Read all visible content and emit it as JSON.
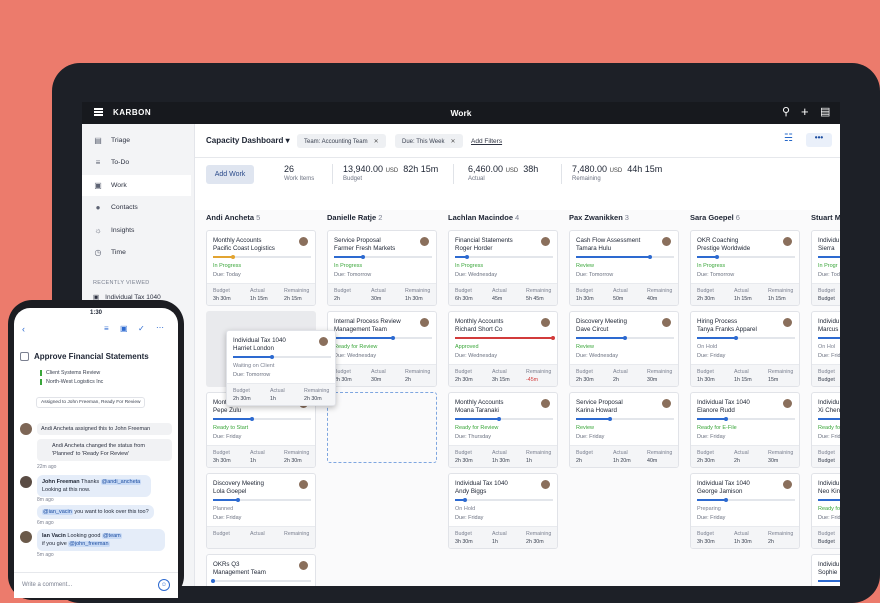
{
  "app": {
    "brand": "KARBON",
    "title": "Work"
  },
  "sidebar": {
    "items": [
      {
        "icon": "triage-icon",
        "label": "Triage"
      },
      {
        "icon": "todo-icon",
        "label": "To-Do"
      },
      {
        "icon": "briefcase-icon",
        "label": "Work"
      },
      {
        "icon": "contacts-icon",
        "label": "Contacts"
      },
      {
        "icon": "insights-icon",
        "label": "Insights"
      },
      {
        "icon": "clock-icon",
        "label": "Time"
      }
    ],
    "recent_heading": "RECENTLY VIEWED",
    "recent": [
      "Individual Tax 1040",
      "Individual Tax 1040"
    ]
  },
  "toolbar": {
    "dashboard": "Capacity Dashboard",
    "chips": [
      "Team: Accounting Team",
      "Due: This Week"
    ],
    "add_filters": "Add Filters",
    "more": "•••"
  },
  "summary": {
    "add_work": "Add Work",
    "work_items": "26",
    "work_items_label": "Work Items",
    "budget": "13,940.00",
    "budget_hours": "82h 15m",
    "budget_label": "Budget",
    "actual": "6,460.00",
    "actual_hours": "38h",
    "actual_label": "Actual",
    "remaining": "7,480.00",
    "remaining_hours": "44h 15m",
    "remaining_label": "Remaining",
    "currency": "USD"
  },
  "footer_labels": {
    "budget": "Budget",
    "actual": "Actual",
    "remaining": "Remaining"
  },
  "columns": [
    {
      "name": "Andi Ancheta",
      "count": "5",
      "cards": [
        {
          "t1": "Monthly Accounts",
          "t2": "Pacific Coast Logistics",
          "status": "In Progress",
          "status_color": "#3aa63a",
          "due": "Due: Today",
          "progress": 0.2,
          "bar": "#e2a431",
          "budget": "3h 30m",
          "actual": "1h 15m",
          "remaining": "2h 15m"
        },
        {
          "t1": "Mont",
          "t2": "Pepe Zulu",
          "status": "Ready to Start",
          "status_color": "#3aa63a",
          "due": "Due: Friday",
          "progress": 0.4,
          "bar": "#2d6ad0",
          "budget": "3h 30m",
          "actual": "1h",
          "remaining": "2h 30m"
        },
        {
          "t1": "Discovery Meeting",
          "t2": "Lola Goepel",
          "status": "Planned",
          "status_color": "#7b8090",
          "due": "Due: Friday",
          "progress": 0.25,
          "bar": "#2d6ad0",
          "budget": "",
          "actual": "",
          "remaining": ""
        },
        {
          "t1": "OKRs Q3",
          "t2": "Management Team",
          "status": "",
          "status_color": "#7b8090",
          "due": "",
          "progress": 0,
          "bar": "#2d6ad0",
          "budget": "",
          "actual": "",
          "remaining": ""
        }
      ]
    },
    {
      "name": "Danielle Ratje",
      "count": "2",
      "cards": [
        {
          "t1": "Service Proposal",
          "t2": "Farmer Fresh Markets",
          "status": "In Progress",
          "status_color": "#3aa63a",
          "due": "Due: Tomorrow",
          "progress": 0.3,
          "bar": "#2d6ad0",
          "budget": "2h",
          "actual": "30m",
          "remaining": "1h 30m"
        },
        {
          "t1": "Internal Process Review",
          "t2": "Management Team",
          "status": "Ready for Review",
          "status_color": "#3aa63a",
          "due": "Due: Wednesday",
          "progress": 0.6,
          "bar": "#2d6ad0",
          "budget": "2h 30m",
          "actual": "30m",
          "remaining": "2h"
        }
      ]
    },
    {
      "name": "Lachlan Macindoe",
      "count": "4",
      "cards": [
        {
          "t1": "Financial Statements",
          "t2": "Roger Horder",
          "status": "In Progress",
          "status_color": "#3aa63a",
          "due": "Due: Wednesday",
          "progress": 0.12,
          "bar": "#2d6ad0",
          "budget": "6h 30m",
          "actual": "45m",
          "remaining": "5h 45m"
        },
        {
          "t1": "Monthly Accounts",
          "t2": "Richard Short Co",
          "status": "Approved",
          "status_color": "#3aa63a",
          "due": "Due: Wednesday",
          "progress": 1,
          "bar": "#d23b3b",
          "budget": "2h 30m",
          "actual": "3h 15m",
          "remaining": "-45m",
          "neg": true
        },
        {
          "t1": "Monthly Accounts",
          "t2": "Moana Taranaki",
          "status": "Ready for Review",
          "status_color": "#3aa63a",
          "due": "Due: Thursday",
          "progress": 0.45,
          "bar": "#2d6ad0",
          "budget": "2h 30m",
          "actual": "1h 30m",
          "remaining": "1h"
        },
        {
          "t1": "Individual Tax 1040",
          "t2": "Andy Biggs",
          "status": "On Hold",
          "status_color": "#7b8090",
          "due": "Due: Friday",
          "progress": 0.1,
          "bar": "#2d6ad0",
          "budget": "3h 30m",
          "actual": "1h",
          "remaining": "2h 30m"
        }
      ]
    },
    {
      "name": "Pax Zwanikken",
      "count": "3",
      "cards": [
        {
          "t1": "Cash Flow Assessment",
          "t2": "Tamara Hulu",
          "status": "Review",
          "status_color": "#3aa63a",
          "due": "Due: Tomorrow",
          "progress": 0.75,
          "bar": "#2d6ad0",
          "budget": "1h 30m",
          "actual": "50m",
          "remaining": "40m"
        },
        {
          "t1": "Discovery Meeting",
          "t2": "Dave Circut",
          "status": "Review",
          "status_color": "#3aa63a",
          "due": "Due: Wednesday",
          "progress": 0.5,
          "bar": "#2d6ad0",
          "budget": "2h 30m",
          "actual": "2h",
          "remaining": "30m"
        },
        {
          "t1": "Service Proposal",
          "t2": "Karina Howard",
          "status": "Review",
          "status_color": "#3aa63a",
          "due": "Due: Friday",
          "progress": 0.35,
          "bar": "#2d6ad0",
          "budget": "2h",
          "actual": "1h 20m",
          "remaining": "40m"
        }
      ]
    },
    {
      "name": "Sara Goepel",
      "count": "6",
      "cards": [
        {
          "t1": "OKR Coaching",
          "t2": "Prestige Worldwide",
          "status": "In Progress",
          "status_color": "#3aa63a",
          "due": "Due: Tomorrow",
          "progress": 0.2,
          "bar": "#2d6ad0",
          "budget": "2h 30m",
          "actual": "1h 15m",
          "remaining": "1h 15m"
        },
        {
          "t1": "Hiring Process",
          "t2": "Tanya Franks Apparel",
          "status": "On Hold",
          "status_color": "#7b8090",
          "due": "Due: Friday",
          "progress": 0.4,
          "bar": "#2d6ad0",
          "budget": "1h 30m",
          "actual": "1h 15m",
          "remaining": "15m"
        },
        {
          "t1": "Individual Tax 1040",
          "t2": "Elanore Rudd",
          "status": "Ready for E-File",
          "status_color": "#3aa63a",
          "due": "Due: Friday",
          "progress": 0.3,
          "bar": "#2d6ad0",
          "budget": "2h 30m",
          "actual": "2h",
          "remaining": "30m"
        },
        {
          "t1": "Individual Tax 1040",
          "t2": "George Jamison",
          "status": "Preparing",
          "status_color": "#7b8090",
          "due": "Due: Friday",
          "progress": 0.3,
          "bar": "#2d6ad0",
          "budget": "3h 30m",
          "actual": "1h 30m",
          "remaining": "2h"
        }
      ]
    },
    {
      "name": "Stuart M",
      "count": "",
      "cards": [
        {
          "t1": "Individu",
          "t2": "Sierra",
          "status": "In Progr",
          "status_color": "#3aa63a",
          "due": "Due: Tod",
          "progress": 0.5,
          "bar": "#2d6ad0",
          "budget": "Budget",
          "actual": "",
          "remaining": ""
        },
        {
          "t1": "Individu",
          "t2": "Marcus",
          "status": "On Hol",
          "status_color": "#7b8090",
          "due": "Due: Frid",
          "progress": 0.5,
          "bar": "#2d6ad0",
          "budget": "Budget",
          "actual": "",
          "remaining": ""
        },
        {
          "t1": "Individu",
          "t2": "Xi Chen",
          "status": "Ready fo",
          "status_color": "#3aa63a",
          "due": "Due: Frid",
          "progress": 0.5,
          "bar": "#2d6ad0",
          "budget": "Budget",
          "actual": "",
          "remaining": ""
        },
        {
          "t1": "Individu",
          "t2": "Neo Kin",
          "status": "Ready fo",
          "status_color": "#3aa63a",
          "due": "Due: Frid",
          "progress": 0.5,
          "bar": "#2d6ad0",
          "budget": "Budget",
          "actual": "",
          "remaining": ""
        },
        {
          "t1": "Individu",
          "t2": "Sophie",
          "status": "",
          "status_color": "#3aa63a",
          "due": "",
          "progress": 0.5,
          "bar": "#2d6ad0",
          "budget": "",
          "actual": "",
          "remaining": ""
        }
      ]
    }
  ],
  "drag_card": {
    "t1": "Individual Tax 1040",
    "t2": "Harriet London",
    "status": "Waiting on Client",
    "due": "Due: Tomorrow",
    "progress": 0.4,
    "budget": "2h 30m",
    "actual": "1h",
    "remaining": "2h 30m"
  },
  "phone": {
    "time": "1:30",
    "title": "Approve Financial Statements",
    "line1": "Client Systems Review",
    "line2": "North-West Logistics Inc",
    "assigned": "Assigned to John Freeman, Ready For Review",
    "a1": "Andi Ancheta assigned this to John Freeman",
    "a2": "Andi Ancheta changed the status from 'Planned' to 'Ready For Review'",
    "t1": "22m ago",
    "m1_name": "John Freeman",
    "m1_text": "Thanks",
    "m1_mention": "@andi_ancheta",
    "m1_rest": "Looking at this now.",
    "t2": "8m ago",
    "m2_mention": "@ian_vacin",
    "m2_text": "you want to look over this too?",
    "t3": "6m ago",
    "m3_name": "Ian Vacin",
    "m3_text": "Looking good",
    "m3_mention": "@team",
    "m3_rest": "if you give",
    "m3_mention2": "@john_freeman",
    "t4": "5m ago",
    "comment": "Write a comment..."
  }
}
